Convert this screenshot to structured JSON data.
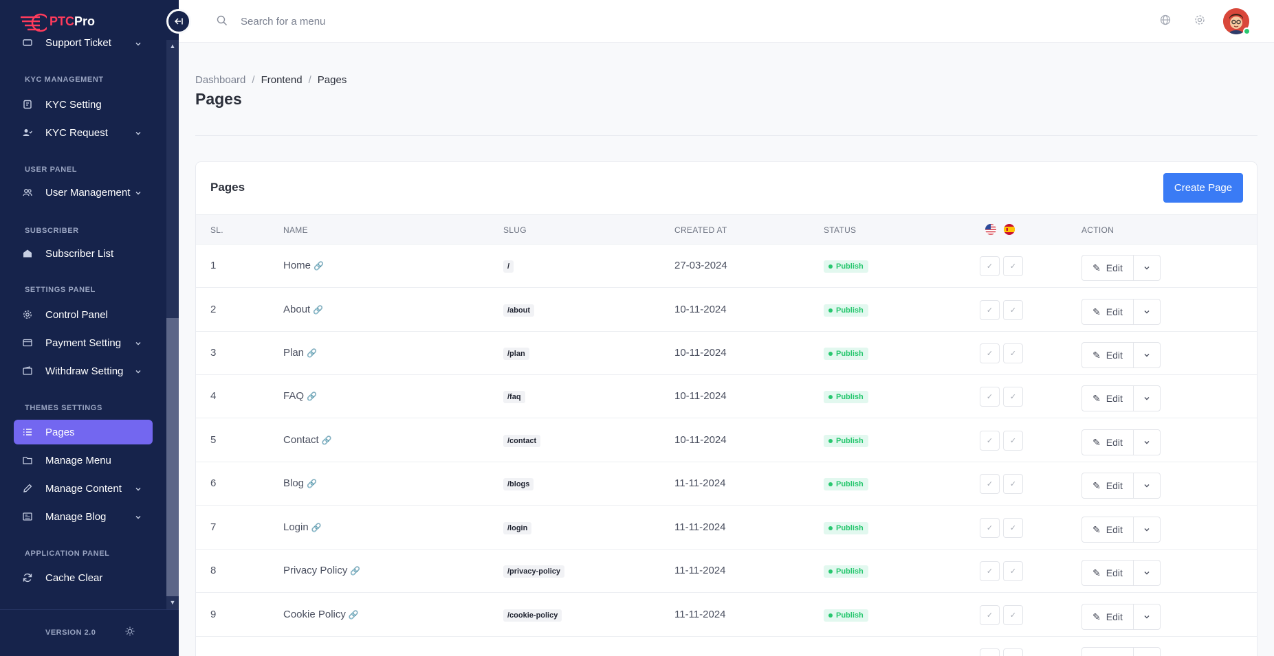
{
  "app": {
    "logo_ptc": "PTC",
    "logo_pro": "Pro",
    "version": "VERSION 2.0"
  },
  "sidebar": {
    "top_item": "Support Ticket",
    "sections": [
      {
        "title": "KYC MANAGEMENT",
        "items": [
          "KYC Setting",
          "KYC Request"
        ]
      },
      {
        "title": "USER PANEL",
        "items": [
          "User Management"
        ]
      },
      {
        "title": "SUBSCRIBER",
        "items": [
          "Subscriber List"
        ]
      },
      {
        "title": "SETTINGS PANEL",
        "items": [
          "Control Panel",
          "Payment Setting",
          "Withdraw Setting"
        ]
      },
      {
        "title": "THEMES SETTINGS",
        "items": [
          "Pages",
          "Manage Menu",
          "Manage Content",
          "Manage Blog"
        ]
      },
      {
        "title": "APPLICATION PANEL",
        "items": [
          "Cache Clear"
        ]
      }
    ]
  },
  "search": {
    "placeholder": "Search for a menu"
  },
  "breadcrumb": [
    "Dashboard",
    "Frontend",
    "Pages"
  ],
  "page_title": "Pages",
  "card": {
    "title": "Pages",
    "create_label": "Create Page",
    "columns": [
      "SL.",
      "NAME",
      "SLUG",
      "CREATED AT",
      "STATUS",
      "ACTION"
    ],
    "edit_label": "Edit",
    "rows": [
      {
        "sl": "1",
        "name": "Home",
        "slug": "/",
        "created": "27-03-2024",
        "status": "Publish"
      },
      {
        "sl": "2",
        "name": "About",
        "slug": "/about",
        "created": "10-11-2024",
        "status": "Publish"
      },
      {
        "sl": "3",
        "name": "Plan",
        "slug": "/plan",
        "created": "10-11-2024",
        "status": "Publish"
      },
      {
        "sl": "4",
        "name": "FAQ",
        "slug": "/faq",
        "created": "10-11-2024",
        "status": "Publish"
      },
      {
        "sl": "5",
        "name": "Contact",
        "slug": "/contact",
        "created": "10-11-2024",
        "status": "Publish"
      },
      {
        "sl": "6",
        "name": "Blog",
        "slug": "/blogs",
        "created": "11-11-2024",
        "status": "Publish"
      },
      {
        "sl": "7",
        "name": "Login",
        "slug": "/login",
        "created": "11-11-2024",
        "status": "Publish"
      },
      {
        "sl": "8",
        "name": "Privacy Policy",
        "slug": "/privacy-policy",
        "created": "11-11-2024",
        "status": "Publish"
      },
      {
        "sl": "9",
        "name": "Cookie Policy",
        "slug": "/cookie-policy",
        "created": "11-11-2024",
        "status": "Publish"
      }
    ]
  },
  "colors": {
    "sidebar_bg": "#16234b",
    "accent": "#7367f0",
    "primary_button": "#3a7bf5",
    "status_green": "#28c76f"
  }
}
